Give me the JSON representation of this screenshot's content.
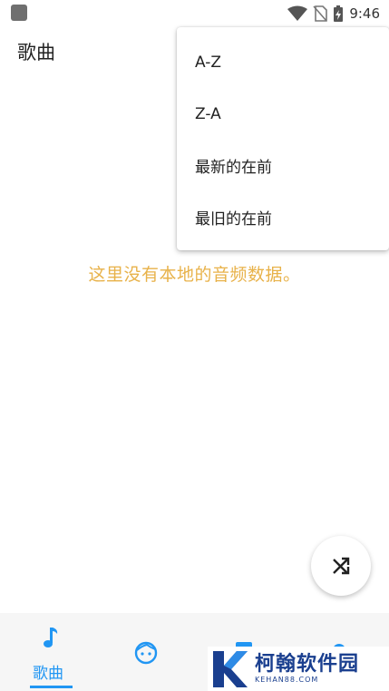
{
  "status_bar": {
    "time": "9:46"
  },
  "app_bar": {
    "title": "歌曲"
  },
  "sort_menu": {
    "items": [
      "A-Z",
      "Z-A",
      "最新的在前",
      "最旧的在前"
    ]
  },
  "empty_state": {
    "message": "这里没有本地的音频数据。"
  },
  "fab": {
    "icon": "shuffle-icon"
  },
  "bottom_nav": {
    "items": [
      {
        "label": "歌曲",
        "icon": "music-note-icon",
        "active": true
      },
      {
        "label": "",
        "icon": "face-icon",
        "active": false
      },
      {
        "label": "",
        "icon": "album-icon",
        "active": false
      },
      {
        "label": "",
        "icon": "settings-icon",
        "active": false
      }
    ]
  },
  "watermark": {
    "title": "柯翰软件园",
    "subtitle": "KEHAN88.COM"
  },
  "colors": {
    "accent": "#2196f3",
    "empty_text": "#e8b24a",
    "watermark": "#1a3f8f"
  }
}
